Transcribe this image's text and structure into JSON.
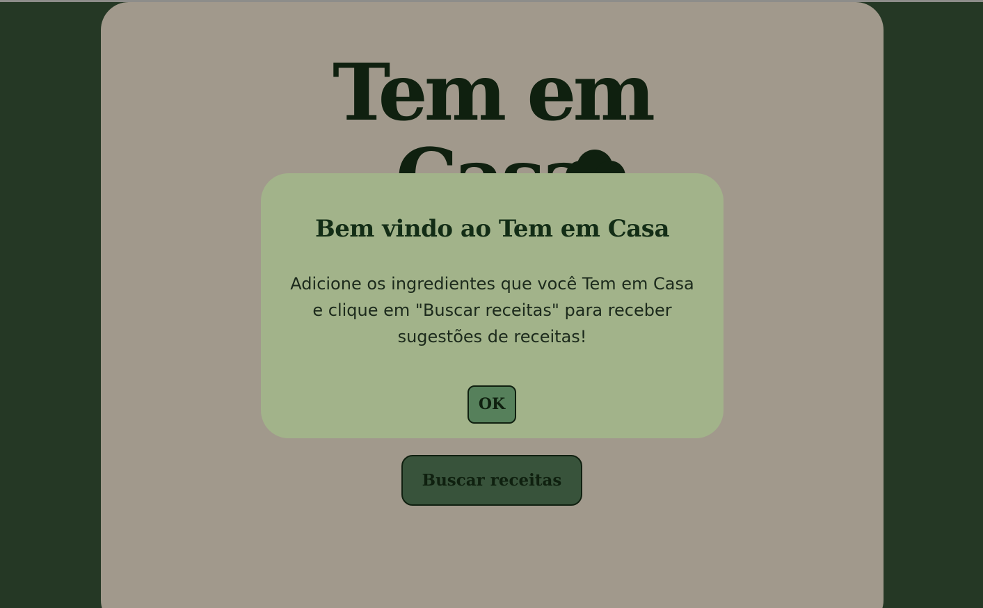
{
  "app": {
    "hero_title_line1": "Tem em",
    "hero_title_line2": "Casa"
  },
  "actions": {
    "search_label": "Buscar receitas"
  },
  "modal": {
    "title": "Bem vindo ao Tem em Casa",
    "message": "Adicione os ingredientes que você Tem em Casa e clique em \"Buscar receitas\" para receber sugestões de receitas!",
    "ok_label": "OK"
  },
  "colors": {
    "page_background": "#253825",
    "card_background": "#a1998c",
    "modal_background": "#a2b38a",
    "button_primary": "#38533b",
    "button_ok": "#56805b",
    "text_dark": "#0f200f"
  },
  "icons": {
    "chef_hat": "chef-hat-icon"
  }
}
